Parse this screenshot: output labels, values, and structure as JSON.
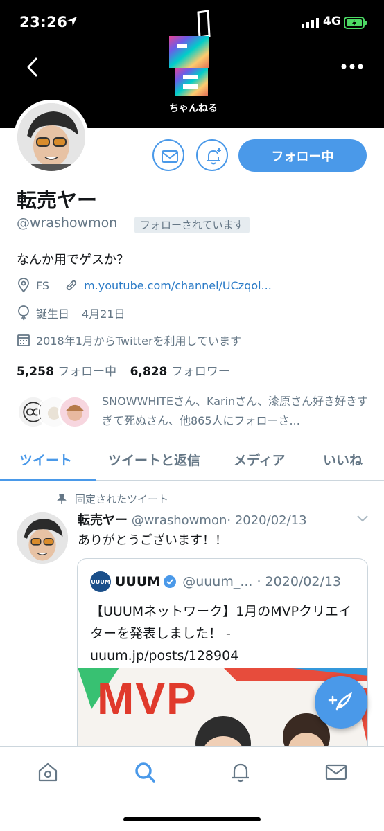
{
  "status_bar": {
    "time": "23:26",
    "network": "4G"
  },
  "banner": {
    "logo_text": "ちゃんねる"
  },
  "profile": {
    "name": "転売ヤー",
    "handle": "@wrashowmon",
    "follows_you_badge": "フォローされています",
    "bio": "なんか用でゲスか？",
    "location": "FS",
    "website": "m.youtube.com/channel/UCzqol...",
    "birthday_label": "誕生日",
    "birthday": "4月21日",
    "joined": "2018年1月からTwitterを利用しています",
    "following_count": "5,258",
    "following_label": "フォロー中",
    "followers_count": "6,828",
    "followers_label": "フォロワー",
    "followed_by_text": "SNOWWHITEさん、Karinさん、漆原さん好き好きすぎて死ぬさん、他865人にフォローさ..."
  },
  "actions": {
    "follow_button": "フォロー中"
  },
  "tabs": [
    {
      "label": "ツイート",
      "active": true
    },
    {
      "label": "ツイートと返信",
      "active": false
    },
    {
      "label": "メディア",
      "active": false
    },
    {
      "label": "いいね",
      "active": false
    }
  ],
  "pinned_tweet": {
    "pinned_label": "固定されたツイート",
    "author_name": "転売ヤー",
    "author_handle": "@wrashowmon",
    "date": "· 2020/02/13",
    "text": "ありがとうございます！！",
    "quote": {
      "logo_text": "UUUM",
      "author_name": "UUUM",
      "author_handle": "@uuum_...",
      "date": "· 2020/02/13",
      "text": "【UUUMネットワーク】1月のMVPクリエイターを発表しました！ - uuum.jp/posts/128904",
      "image_text": "MVP"
    }
  },
  "colors": {
    "accent": "#4a99e9",
    "text": "#14171a",
    "secondary": "#657786"
  }
}
